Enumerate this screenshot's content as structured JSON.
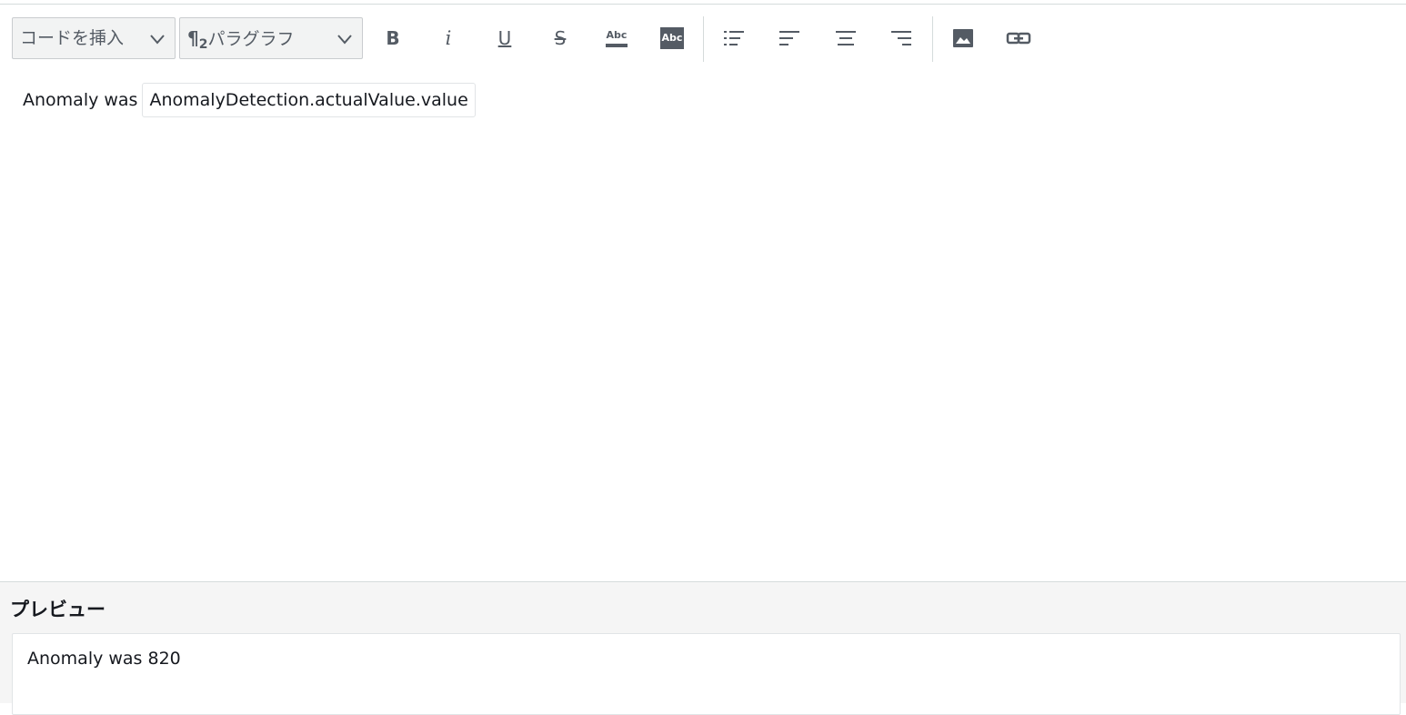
{
  "toolbar": {
    "insert_code_label": "コードを挿入",
    "paragraph_label": "パラグラフ",
    "paragraph_glyph": "¶",
    "paragraph_level": "2",
    "bold_glyph": "B",
    "italic_glyph": "i",
    "underline_glyph": "U",
    "strikethrough_glyph": "S",
    "text_color_glyph": "Abc",
    "highlight_glyph": "Abc",
    "icons": [
      "bulleted-list-icon",
      "align-left-icon",
      "align-center-icon",
      "align-right-icon",
      "image-icon",
      "link-icon"
    ]
  },
  "editor": {
    "text": "Anomaly was",
    "variable": "AnomalyDetection.actualValue.value"
  },
  "preview": {
    "title": "プレビュー",
    "text": "Anomaly was 820"
  },
  "colors": {
    "icon": "#545b64",
    "border": "#d5dbdb",
    "preview_bg": "#f5f5f5"
  }
}
